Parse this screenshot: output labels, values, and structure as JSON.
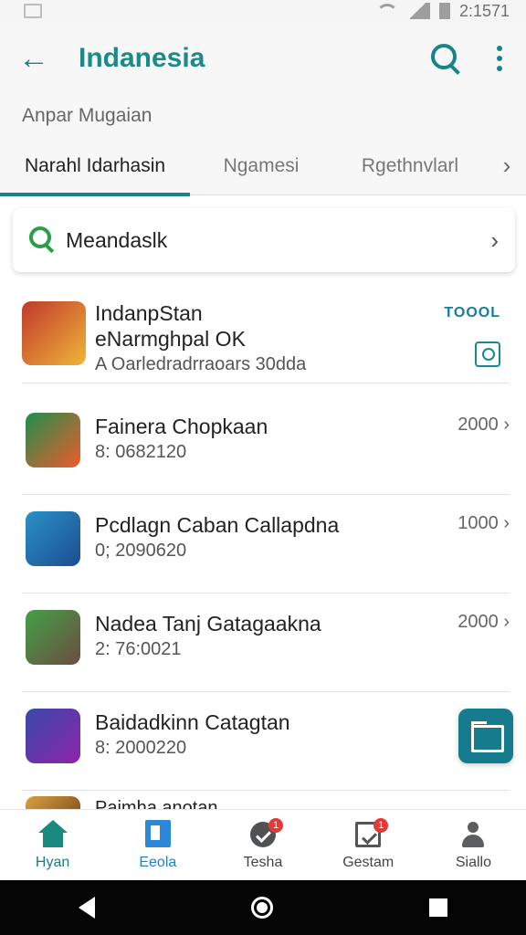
{
  "status_bar": {
    "time": "2:1571"
  },
  "app_bar": {
    "title": "Indanesia"
  },
  "subtitle": "Anpar Mugaian",
  "tabs": [
    {
      "label": "Narahl Idarhasin",
      "active": true
    },
    {
      "label": "Ngamesi",
      "active": false
    },
    {
      "label": "Rgethnvlarl",
      "active": false
    }
  ],
  "search_card": {
    "text": "Meandaslk"
  },
  "featured_app": {
    "title_line1": "IndanpStan",
    "title_line2": "eNarmghpal OK",
    "subtitle": "A Oarledradrraoars 30dda",
    "label": "TOOOL"
  },
  "apps": [
    {
      "name": "Fainera Chopkaan",
      "meta": "8: 0682120",
      "price": "2000"
    },
    {
      "name": "Pcdlagn Caban Callapdna",
      "meta": "0; 2090620",
      "price": "1000"
    },
    {
      "name": "Nadea Tanj Gatagaakna",
      "meta": "2: 76:0021",
      "price": "2000"
    },
    {
      "name": "Baidadkinn Catagtan",
      "meta": "8: 2000220",
      "price": ""
    }
  ],
  "partial_item": {
    "name": "Paimha anotan"
  },
  "bottom_nav": [
    {
      "label": "Hyan"
    },
    {
      "label": "Eeola"
    },
    {
      "label": "Tesha",
      "badge": "1"
    },
    {
      "label": "Gestam",
      "badge": "1"
    },
    {
      "label": "Siallo"
    }
  ]
}
